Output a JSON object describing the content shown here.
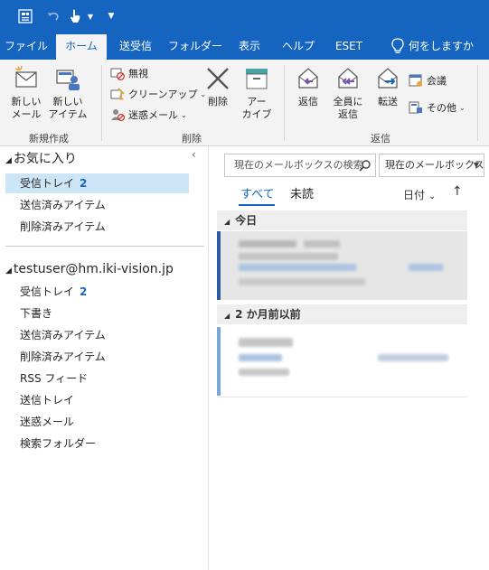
{
  "quick_access": {
    "icons": [
      "send-receive-icon",
      "undo-icon",
      "touch-mode-icon",
      "customize-qat-icon"
    ],
    "colors": {
      "title_bar": "#1565c0"
    }
  },
  "tabs": [
    {
      "label": "ファイル",
      "active": false
    },
    {
      "label": "ホーム",
      "active": true
    },
    {
      "label": "送受信",
      "active": false
    },
    {
      "label": "フォルダー",
      "active": false
    },
    {
      "label": "表示",
      "active": false
    },
    {
      "label": "ヘルプ",
      "active": false
    },
    {
      "label": "ESET",
      "active": false
    }
  ],
  "tell_me": {
    "label": "何をしますか",
    "icon": "lightbulb-icon"
  },
  "ribbon": {
    "new_group": {
      "label": "新規作成",
      "new_mail": "新しい\nメール",
      "new_items": "新しい\nアイテム"
    },
    "delete_group": {
      "label": "削除",
      "ignore": "無視",
      "cleanup": "クリーンアップ",
      "junk": "迷惑メール",
      "delete": "削除",
      "archive": "アー\nカイブ"
    },
    "respond_group": {
      "label": "返信",
      "reply": "返信",
      "reply_all": "全員に\n返信",
      "forward": "転送",
      "meeting": "会議",
      "more": "その他"
    }
  },
  "left_pane": {
    "favorites_header": "お気に入り",
    "favorites": [
      {
        "label": "受信トレイ",
        "count": "2",
        "selected": true
      },
      {
        "label": "送信済みアイテム",
        "count": "",
        "selected": false
      },
      {
        "label": "削除済みアイテム",
        "count": "",
        "selected": false
      }
    ],
    "account": "testuser@hm.iki-vision.jp",
    "folders": [
      {
        "label": "受信トレイ",
        "count": "2"
      },
      {
        "label": "下書き",
        "count": ""
      },
      {
        "label": "送信済みアイテム",
        "count": ""
      },
      {
        "label": "削除済みアイテム",
        "count": ""
      },
      {
        "label": "RSS フィード",
        "count": ""
      },
      {
        "label": "送信トレイ",
        "count": ""
      },
      {
        "label": "迷惑メール",
        "count": ""
      },
      {
        "label": "検索フォルダー",
        "count": ""
      }
    ]
  },
  "message_list": {
    "search_placeholder": "現在のメールボックスの検索",
    "search_scope": "現在のメールボックス",
    "filter_all": "すべて",
    "filter_unread": "未読",
    "sort_label": "日付",
    "groups": [
      {
        "label": "今日"
      },
      {
        "label": "2 か月前以前"
      }
    ],
    "colors": {
      "accent": "#1565c0",
      "selected_item": "#cde6f7",
      "unread_bar": "#2b5aa0"
    }
  }
}
